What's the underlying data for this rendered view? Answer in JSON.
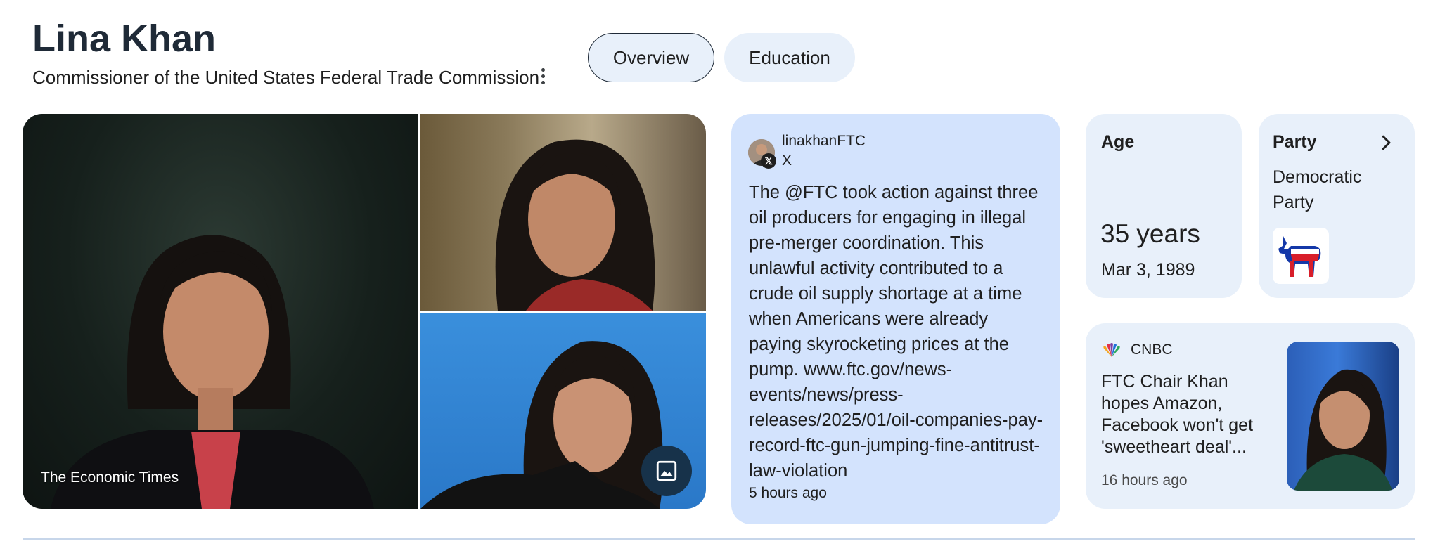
{
  "header": {
    "title": "Lina Khan",
    "subtitle": "Commissioner of the United States Federal Trade Commission",
    "more_icon": "more-vert-icon"
  },
  "tabs": [
    {
      "label": "Overview",
      "selected": true
    },
    {
      "label": "Education",
      "selected": false
    }
  ],
  "images": {
    "main_caption": "The Economic Times",
    "gallery_icon": "image-gallery-icon"
  },
  "tweet": {
    "handle": "linakhanFTC",
    "platform": "X",
    "text": "The @FTC took action against three oil producers for engaging in illegal pre-merger coordination. This unlawful activity contributed to a crude oil supply shortage at a time when Americans were already paying skyrocketing prices at the pump. www.ftc.gov/news-events/news/press-releases/2025/01/oil-companies-pay-record-ftc-gun-jumping-fine-antitrust-law-violation",
    "time": "5 hours ago"
  },
  "age": {
    "label": "Age",
    "value": "35 years",
    "birth_date": "Mar 3, 1989"
  },
  "party": {
    "label": "Party",
    "value": "Democratic Party",
    "chevron_icon": "chevron-right-icon",
    "logo_icon": "democratic-donkey-icon"
  },
  "news": {
    "source": "CNBC",
    "title": "FTC Chair Khan hopes Amazon, Facebook won't get 'sweetheart deal'...",
    "time": "16 hours ago"
  },
  "colors": {
    "tweet_bg": "#d3e3fd",
    "card_bg": "#e8f0fa",
    "title": "#1f2a37",
    "gallery_button": "#17324a"
  }
}
